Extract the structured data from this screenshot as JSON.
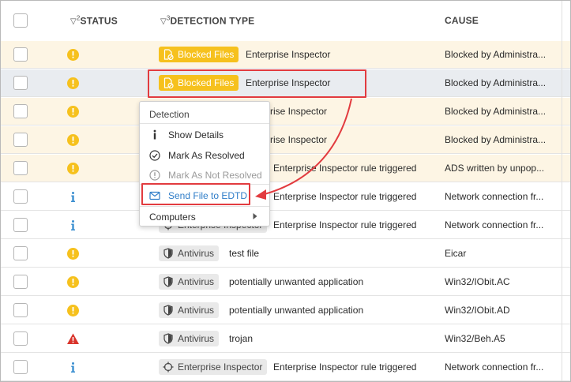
{
  "header": {
    "status_label": "STATUS",
    "status_sort_num": "2",
    "type_label": "DETECTION TYPE",
    "type_sort_num": "3",
    "cause_label": "CAUSE"
  },
  "rows": [
    {
      "status": "warning",
      "badge": "Blocked Files",
      "badge_style": "yellow",
      "badge_icon": "blocked-file-icon",
      "type": "Enterprise Inspector",
      "cause": "Blocked by Administra..."
    },
    {
      "status": "warning",
      "badge": "Blocked Files",
      "badge_style": "yellow",
      "badge_icon": "blocked-file-icon",
      "type": "Enterprise Inspector",
      "cause": "Blocked by Administra..."
    },
    {
      "status": "warning",
      "badge": "",
      "badge_style": "",
      "badge_icon": "",
      "type": "rise Inspector",
      "cause": "Blocked by Administra..."
    },
    {
      "status": "warning",
      "badge": "",
      "badge_style": "",
      "badge_icon": "",
      "type": "rise Inspector",
      "cause": "Blocked by Administra..."
    },
    {
      "status": "warning",
      "badge": "",
      "badge_style": "",
      "badge_icon": "",
      "type": "Enterprise Inspector rule triggered",
      "cause": "ADS written by unpop..."
    },
    {
      "status": "info",
      "badge": "",
      "badge_style": "",
      "badge_icon": "",
      "type": "Enterprise Inspector rule triggered",
      "cause": "Network connection fr..."
    },
    {
      "status": "info",
      "badge": "Enterprise Inspector",
      "badge_style": "grey",
      "badge_icon": "crosshair-icon",
      "type": "Enterprise Inspector rule triggered",
      "cause": "Network connection fr..."
    },
    {
      "status": "warning",
      "badge": "Antivirus",
      "badge_style": "grey",
      "badge_icon": "shield-icon",
      "type": "test file",
      "cause": "Eicar"
    },
    {
      "status": "warning",
      "badge": "Antivirus",
      "badge_style": "grey",
      "badge_icon": "shield-icon",
      "type": "potentially unwanted application",
      "cause": "Win32/IObit.AC"
    },
    {
      "status": "warning",
      "badge": "Antivirus",
      "badge_style": "grey",
      "badge_icon": "shield-icon",
      "type": "potentially unwanted application",
      "cause": "Win32/IObit.AD"
    },
    {
      "status": "critical",
      "badge": "Antivirus",
      "badge_style": "grey",
      "badge_icon": "shield-icon",
      "type": "trojan",
      "cause": "Win32/Beh.A5"
    },
    {
      "status": "info",
      "badge": "Enterprise Inspector",
      "badge_style": "grey",
      "badge_icon": "crosshair-icon",
      "type": "Enterprise Inspector rule triggered",
      "cause": "Network connection fr..."
    }
  ],
  "context_menu": {
    "header": "Detection",
    "items": [
      {
        "label": "Show Details",
        "icon": "info-icon",
        "state": "enabled"
      },
      {
        "label": "Mark As Resolved",
        "icon": "check-circle-icon",
        "state": "enabled"
      },
      {
        "label": "Mark As Not Resolved",
        "icon": "exclamation-circle-icon",
        "state": "disabled"
      },
      {
        "label": "Send File to EDTD",
        "icon": "envelope-icon",
        "state": "highlighted"
      },
      {
        "label": "Computers",
        "icon": "chevron-right-icon",
        "state": "submenu"
      }
    ]
  },
  "colors": {
    "warning_yellow": "#f6c11d",
    "info_blue": "#3b8fd0",
    "critical_red": "#d9342b",
    "highlight_red": "#e23b3f",
    "row_warn_bg": "#fdf5e4",
    "row_selected_bg": "#e9ecf0",
    "link_blue": "#2f7dc8"
  }
}
